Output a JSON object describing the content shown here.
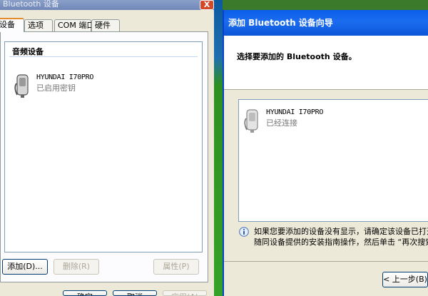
{
  "left_window": {
    "title": "Bluetooth 设备",
    "close_glyph": "X",
    "tabs": [
      "设备",
      "选项",
      "COM 端口",
      "硬件"
    ],
    "group_header": "音频设备",
    "device": {
      "name": "HYUNDAI I70PRO",
      "status": "已启用密钥",
      "icon": "headset-device-icon"
    },
    "buttons": {
      "add": "添加(D)...",
      "remove": "删除(R)",
      "properties": "属性(P)"
    },
    "bottom_buttons": [
      "确定",
      "取消",
      "应用(A)"
    ]
  },
  "right_window": {
    "title": "添加 Bluetooth 设备向导",
    "heading": "选择要添加的 Bluetooth 设备。",
    "device": {
      "name": "HYUNDAI I70PRO",
      "status": "已经连接",
      "icon": "headset-device-icon"
    },
    "info_lines": [
      "如果您要添加的设备没有显示，请确定该设备已打开。",
      "随同设备提供的安装指南操作，然后单击 “再次搜索”"
    ],
    "info_icon": "info-icon",
    "back_button": "< 上一步(B)"
  },
  "colors": {
    "dialog_bg": "#ece9d8",
    "title_blue": "#0a5ee8",
    "active_tab_accent": "#e68b2c",
    "close_red": "#d24a2a"
  }
}
